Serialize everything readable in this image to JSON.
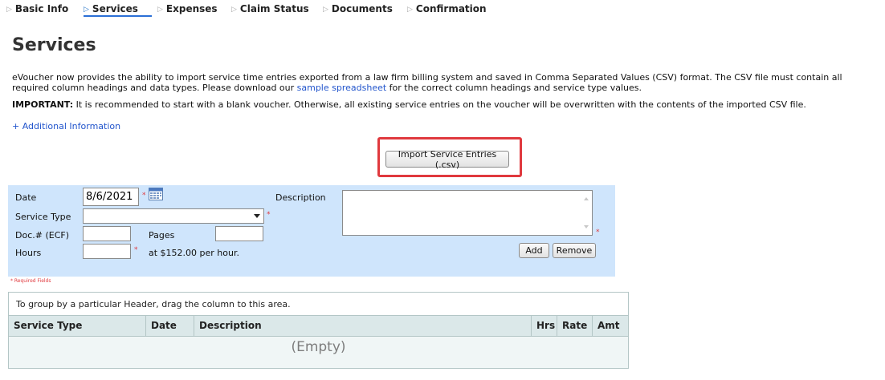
{
  "tabs": [
    {
      "label": "Basic Info",
      "active": false
    },
    {
      "label": "Services",
      "active": true
    },
    {
      "label": "Expenses",
      "active": false
    },
    {
      "label": "Claim Status",
      "active": false
    },
    {
      "label": "Documents",
      "active": false
    },
    {
      "label": "Confirmation",
      "active": false
    }
  ],
  "page": {
    "title": "Services",
    "intro_before_link": "eVoucher now provides the ability to import service time entries exported from a law firm billing system and saved in Comma Separated Values (CSV) format. The CSV file must contain all required column headings and data types. Please download our ",
    "intro_link": "sample spreadsheet",
    "intro_after_link": " for the correct column headings and service type values.",
    "important_label": "IMPORTANT:",
    "important_text": " It is recommended to start with a blank voucher. Otherwise, all existing service entries on the voucher will be overwritten with the contents of the imported CSV file.",
    "additional_info": "+ Additional Information",
    "import_button": "Import Service Entries (.csv)",
    "highlight_color": "#e0393e"
  },
  "form": {
    "date_label": "Date",
    "date_value": "8/6/2021",
    "service_type_label": "Service Type",
    "service_type_value": "",
    "doc_label": "Doc.# (ECF)",
    "doc_value": "",
    "pages_label": "Pages",
    "pages_value": "",
    "hours_label": "Hours",
    "hours_value": "",
    "rate_text": "at $152.00 per hour.",
    "description_label": "Description",
    "description_value": "",
    "add_button": "Add",
    "remove_button": "Remove",
    "required_marker": "*",
    "required_fields_note": "* Required Fields",
    "panel_color": "#cfe5fc"
  },
  "grid": {
    "group_hint": "To group by a particular Header, drag the column to this area.",
    "columns": [
      "Service Type",
      "Date",
      "Description",
      "Hrs",
      "Rate",
      "Amt"
    ],
    "empty_text": "(Empty)"
  }
}
